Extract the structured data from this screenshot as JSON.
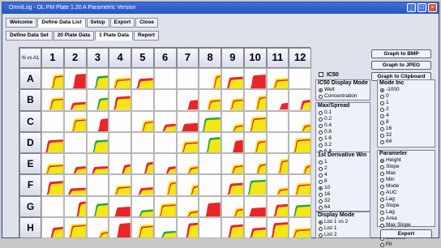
{
  "window": {
    "title": "OmniLog - OL PM Plate 1.20 A Parametric Version"
  },
  "tabs_primary": [
    "Welcome",
    "Define Data List",
    "Setup",
    "Export",
    "Close"
  ],
  "tabs_secondary": [
    "Define Data Set",
    "20 Plate Data",
    "1 Plate Data",
    "Report"
  ],
  "plate": {
    "corner": "% vs A1",
    "columns": [
      "1",
      "2",
      "3",
      "4",
      "5",
      "6",
      "7",
      "8",
      "9",
      "10",
      "11",
      "12"
    ],
    "rows": [
      "A",
      "B",
      "C",
      "D",
      "E",
      "F",
      "G",
      "H"
    ]
  },
  "colors": {
    "red": "#e8262a",
    "yellow": "#f4e617",
    "green": "#2aa43c"
  },
  "buttons": {
    "bmp": "Graph to BMP",
    "jpeg": "Graph to JPEG",
    "clipboard": "Graph to Clipboard",
    "export": "Export"
  },
  "ic50": {
    "label": "IC50"
  },
  "ic50_display": {
    "title": "IC50 Display Mode",
    "options": [
      "Well",
      "Concentration"
    ]
  },
  "max_spread": {
    "title": "Max/Spread",
    "options": [
      "0.1",
      "0.2",
      "0.4",
      "0.8",
      "1.6",
      "3.2",
      "6.4"
    ]
  },
  "derivative": {
    "title": "1st Derivative Win",
    "options": [
      "1",
      "2",
      "4",
      "8",
      "10",
      "16",
      "32",
      "64"
    ]
  },
  "display_mode": {
    "title": "Display Mode",
    "options": [
      "List 1 vs 2",
      "List 1",
      "List 2"
    ]
  },
  "mode_inc": {
    "title": "Mode Inc",
    "options": [
      "-1000",
      "0",
      "1",
      "2",
      "4",
      "8",
      "16",
      "32",
      "64"
    ]
  },
  "parameter": {
    "title": "Parameter",
    "options": [
      "Height",
      "Slope",
      "Max",
      "Min",
      "Mode",
      "AUC",
      "Lag",
      "Slope",
      "Lag",
      "Area",
      "Max Slope",
      "Inflection",
      "Baseline",
      "Fit"
    ]
  }
}
